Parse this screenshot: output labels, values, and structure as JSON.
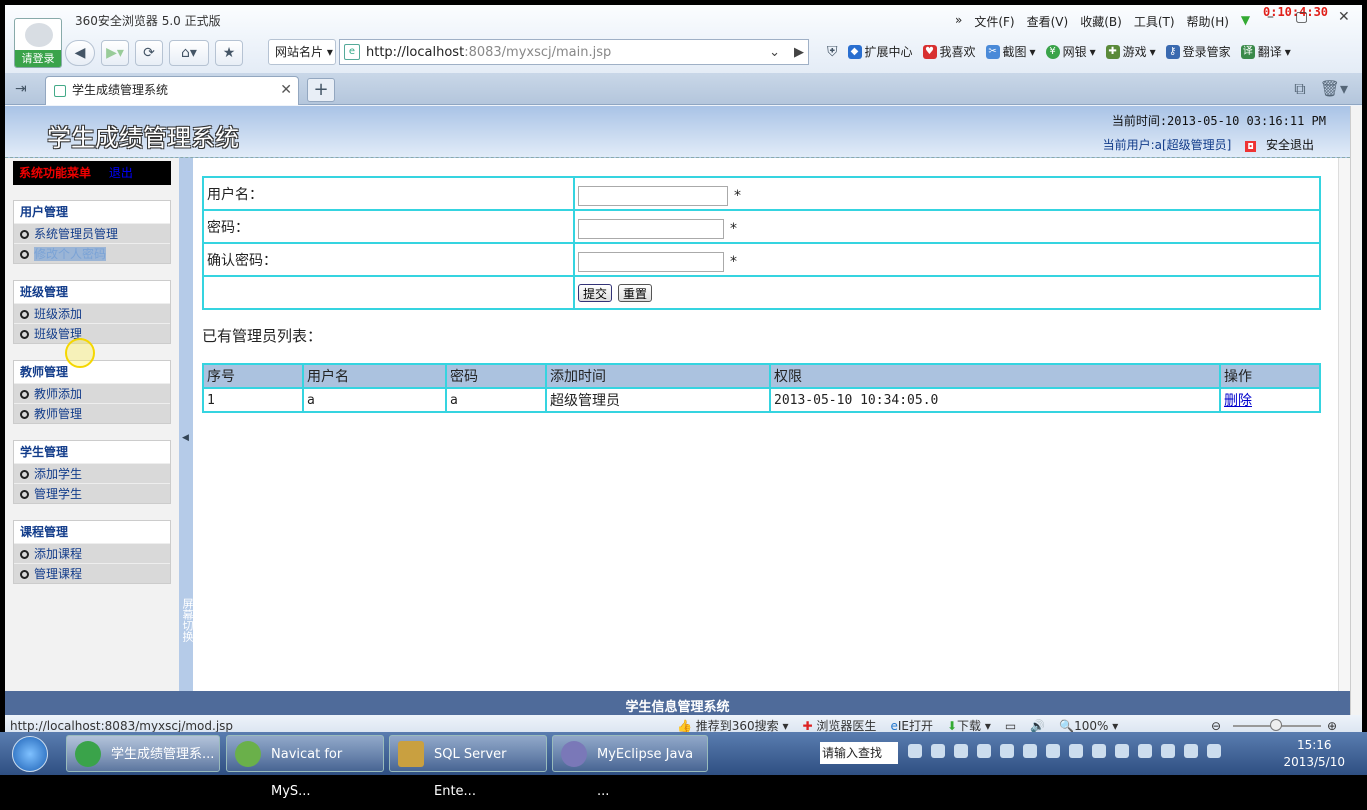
{
  "browser": {
    "app_title": "360安全浏览器 5.0 正式版",
    "login_label": "请登录",
    "menus": [
      "文件(F)",
      "查看(V)",
      "收藏(B)",
      "工具(T)",
      "帮助(H)"
    ],
    "timer": "0:10:4:30",
    "web_card_label": "网站名片",
    "address_host": "http://localhost",
    "address_rest": ":8083/myxscj/main.jsp",
    "extensions": [
      "扩展中心",
      "我喜欢",
      "截图",
      "网银",
      "游戏",
      "登录管家",
      "翻译"
    ],
    "tab_title": "学生成绩管理系统",
    "status_url": "http://localhost:8083/myxscj/mod.jsp",
    "status_items": [
      "推荐到360搜索",
      "浏览器医生",
      "IE打开",
      "下载",
      "100%"
    ]
  },
  "page": {
    "title": "学生成绩管理系统",
    "current_time": "当前时间:2013-05-10 03:16:11 PM",
    "current_user": "当前用户:a[超级管理员]",
    "logout": "安全退出",
    "footer": "学生信息管理系统",
    "splitter_text": "屏幕切换"
  },
  "sidebar": {
    "menu_title": "系统功能菜单",
    "menu_exit": "退出",
    "groups": [
      {
        "title": "用户管理",
        "items": [
          "系统管理员管理",
          "修改个人密码"
        ]
      },
      {
        "title": "班级管理",
        "items": [
          "班级添加",
          "班级管理"
        ]
      },
      {
        "title": "教师管理",
        "items": [
          "教师添加",
          "教师管理"
        ]
      },
      {
        "title": "学生管理",
        "items": [
          "添加学生",
          "管理学生"
        ]
      },
      {
        "title": "课程管理",
        "items": [
          "添加课程",
          "管理课程"
        ]
      }
    ]
  },
  "form": {
    "username_label": "用户名：",
    "password_label": "密码：",
    "confirm_label": "确认密码：",
    "username_value": "",
    "password_value": "",
    "confirm_value": "",
    "required_mark": "*",
    "submit": "提交",
    "reset": "重置"
  },
  "admin_list": {
    "label": "已有管理员列表：",
    "headers": [
      "序号",
      "用户名",
      "密码",
      "添加时间",
      "权限",
      "操作"
    ],
    "rows": [
      {
        "seq": "1",
        "username": "a",
        "password": "a",
        "added": "2013-05-10 10:34:05.0",
        "role": "超级管理员",
        "action": "删除"
      }
    ]
  },
  "taskbar": {
    "tasks": [
      "学生成绩管理系...",
      "Navicat for MyS...",
      "SQL Server Ente...",
      "MyEclipse Java ..."
    ],
    "search_placeholder": "请输入查找",
    "time": "15:16",
    "date": "2013/5/10"
  }
}
